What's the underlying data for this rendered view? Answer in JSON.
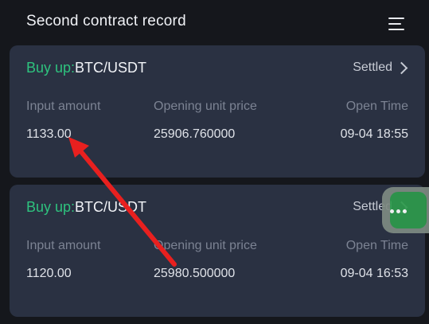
{
  "header": {
    "title": "Second contract record",
    "menu_icon": "menu-icon"
  },
  "records": [
    {
      "direction": "Buy up:",
      "symbol": "BTC/USDT",
      "status": "Settled",
      "labels": {
        "amount": "Input amount",
        "price": "Opening unit price",
        "time": "Open Time"
      },
      "amount": "1133.00",
      "price": "25906.760000",
      "time": "09-04 18:55"
    },
    {
      "direction": "Buy up:",
      "symbol": "BTC/USDT",
      "status": "Settled",
      "labels": {
        "amount": "Input amount",
        "price": "Opening unit price",
        "time": "Open Time"
      },
      "amount": "1120.00",
      "price": "25980.500000",
      "time": "09-04 16:53"
    }
  ],
  "colors": {
    "buy": "#2ec27e",
    "annotation_arrow": "#e8201f",
    "card_bg": "#2a3142",
    "page_bg": "#15171c"
  }
}
